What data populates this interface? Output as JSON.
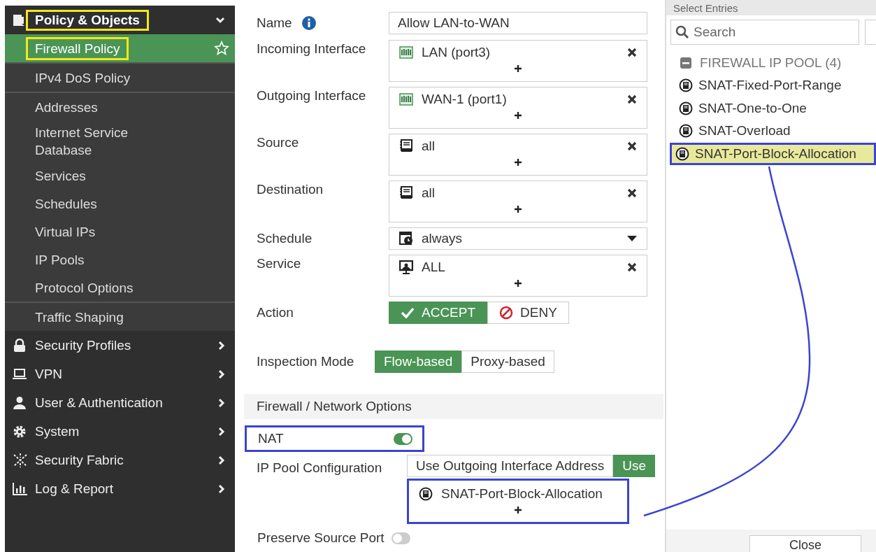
{
  "sidebar": {
    "sections": [
      {
        "label": "Policy & Objects",
        "expanded": true,
        "highlighted": true,
        "groups": [
          {
            "items": [
              {
                "label": "Firewall Policy",
                "selected": true,
                "highlighted": true
              }
            ]
          },
          {
            "items": [
              {
                "label": "IPv4 DoS Policy",
                "selected": false,
                "highlighted": false
              }
            ]
          },
          {
            "items": [
              {
                "label": "Addresses",
                "selected": false,
                "highlighted": false
              },
              {
                "label": "Internet Service Database",
                "selected": false,
                "highlighted": false
              },
              {
                "label": "Services",
                "selected": false,
                "highlighted": false
              },
              {
                "label": "Schedules",
                "selected": false,
                "highlighted": false
              },
              {
                "label": "Virtual IPs",
                "selected": false,
                "highlighted": false
              },
              {
                "label": "IP Pools",
                "selected": false,
                "highlighted": false
              },
              {
                "label": "Protocol Options",
                "selected": false,
                "highlighted": false
              }
            ]
          },
          {
            "items": [
              {
                "label": "Traffic Shaping",
                "selected": false,
                "highlighted": false
              }
            ]
          }
        ]
      },
      {
        "label": "Security Profiles",
        "expanded": false,
        "highlighted": false
      },
      {
        "label": "VPN",
        "expanded": false,
        "highlighted": false
      },
      {
        "label": "User & Authentication",
        "expanded": false,
        "highlighted": false
      },
      {
        "label": "System",
        "expanded": false,
        "highlighted": false
      },
      {
        "label": "Security Fabric",
        "expanded": false,
        "highlighted": false
      },
      {
        "label": "Log & Report",
        "expanded": false,
        "highlighted": false
      }
    ]
  },
  "form": {
    "rows": [
      {
        "kind": "text",
        "label": "Name",
        "info": true,
        "value": "Allow LAN-to-WAN"
      },
      {
        "kind": "multi",
        "label": "Incoming Interface",
        "entries": [
          {
            "kind": "interface",
            "text": "LAN (port3)"
          }
        ]
      },
      {
        "kind": "multi",
        "label": "Outgoing Interface",
        "entries": [
          {
            "kind": "interface",
            "text": "WAN-1 (port1)"
          }
        ]
      },
      {
        "kind": "multi",
        "label": "Source",
        "entries": [
          {
            "kind": "address",
            "text": "all"
          }
        ]
      },
      {
        "kind": "multi",
        "label": "Destination",
        "entries": [
          {
            "kind": "address",
            "text": "all"
          }
        ]
      },
      {
        "kind": "select",
        "label": "Schedule",
        "entry": {
          "kind": "schedule",
          "text": "always"
        }
      },
      {
        "kind": "multi",
        "label": "Service",
        "entries": [
          {
            "kind": "service",
            "text": "ALL"
          }
        ]
      },
      {
        "kind": "segmented",
        "label": "Action",
        "options": [
          {
            "kind": "accept",
            "text": "ACCEPT",
            "selected": true
          },
          {
            "kind": "deny",
            "text": "DENY",
            "selected": false
          }
        ]
      },
      {
        "kind": "segmented",
        "label": "Inspection Mode",
        "options": [
          {
            "text": "Flow-based",
            "selected": true
          },
          {
            "text": "Proxy-based",
            "selected": false
          }
        ]
      },
      {
        "kind": "section",
        "label": "Firewall / Network Options"
      },
      {
        "kind": "toggle",
        "label": "NAT",
        "on": true,
        "highlighted": true
      },
      {
        "kind": "pool",
        "label": "IP Pool Configuration",
        "options": [
          {
            "text": "Use Outgoing Interface Address",
            "selected": false
          },
          {
            "text": "Use",
            "selected": true
          }
        ],
        "entries": [
          {
            "kind": "ippool",
            "text": "SNAT-Port-Block-Allocation"
          }
        ],
        "highlighted": true
      },
      {
        "kind": "toggle",
        "label": "Preserve Source Port",
        "on": false,
        "highlighted": false
      }
    ]
  },
  "panel": {
    "title": "Select Entries",
    "search": {
      "placeholder": "Search"
    },
    "group": {
      "label": "FIREWALL IP POOL (4)",
      "expanded": true
    },
    "entries": [
      {
        "text": "SNAT-Fixed-Port-Range",
        "selected": false
      },
      {
        "text": "SNAT-One-to-One",
        "selected": false
      },
      {
        "text": "SNAT-Overload",
        "selected": false
      },
      {
        "text": "SNAT-Port-Block-Allocation",
        "selected": true
      }
    ],
    "close": "Close"
  }
}
